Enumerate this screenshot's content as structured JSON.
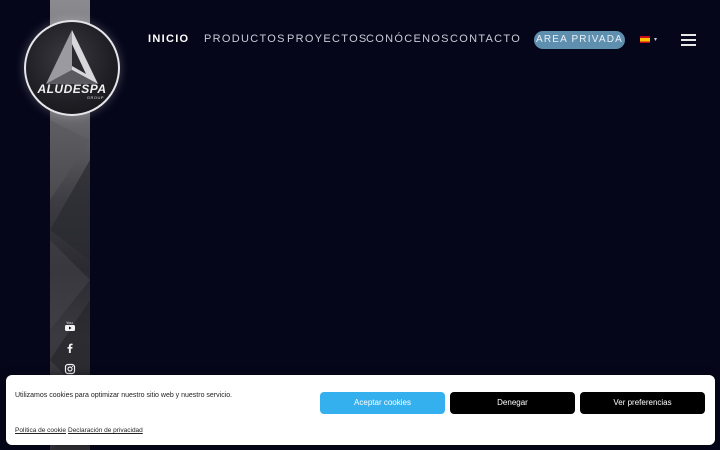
{
  "brand": {
    "logo_text": "ALUDESPA",
    "logo_subtext": "GROUP"
  },
  "nav": {
    "items": [
      {
        "label": "INICIO",
        "active": true
      },
      {
        "label": "PRODUCTOS",
        "active": false
      },
      {
        "label": "PROYECTOS",
        "active": false
      },
      {
        "label": "CONÓCENOS",
        "active": false
      },
      {
        "label": "CONTACTO",
        "active": false
      }
    ],
    "area_button_label": "AREA PRIVADA",
    "language": "es",
    "language_caret": "▾"
  },
  "social": [
    {
      "icon": "youtube-icon"
    },
    {
      "icon": "facebook-icon"
    },
    {
      "icon": "instagram-icon"
    }
  ],
  "cookie_banner": {
    "message": "Utilizamos cookies para optimizar nuestro sitio web y nuestro servicio.",
    "accept_label": "Aceptar cookies",
    "deny_label": "Denegar",
    "preferences_label": "Ver preferencias",
    "cookie_policy_label": "Política de cookie",
    "privacy_label": "Declaración de privacidad"
  },
  "colors": {
    "background": "#050619",
    "accent_button": "#5f8fae",
    "accept_button": "#35b0ef"
  }
}
